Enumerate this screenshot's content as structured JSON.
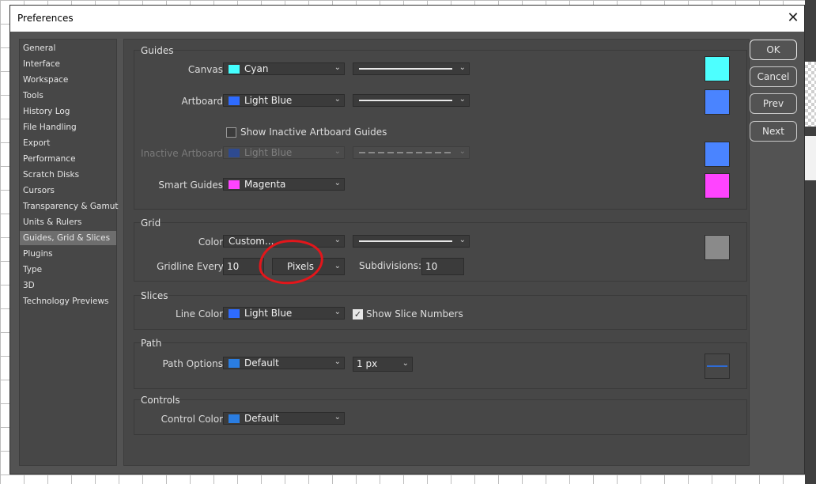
{
  "dialog": {
    "title": "Preferences"
  },
  "sidebar": {
    "items": [
      "General",
      "Interface",
      "Workspace",
      "Tools",
      "History Log",
      "File Handling",
      "Export",
      "Performance",
      "Scratch Disks",
      "Cursors",
      "Transparency & Gamut",
      "Units & Rulers",
      "Guides, Grid & Slices",
      "Plugins",
      "Type",
      "3D",
      "Technology Previews"
    ],
    "selected": "Guides, Grid & Slices"
  },
  "guides": {
    "title": "Guides",
    "canvas": {
      "label": "Canvas:",
      "color_name": "Cyan",
      "color": "#44ffff",
      "swatch": "#4dffff"
    },
    "artboard": {
      "label": "Artboard:",
      "color_name": "Light Blue",
      "color": "#2e6bff",
      "swatch": "#4a84ff"
    },
    "show_inactive": {
      "label": "Show Inactive Artboard Guides",
      "checked": false
    },
    "inactive_artboard": {
      "label": "Inactive Artboard:",
      "color_name": "Light Blue",
      "color": "#2e4a90",
      "swatch": "#4a84ff"
    },
    "smart_guides": {
      "label": "Smart Guides:",
      "color_name": "Magenta",
      "color": "#ff44ff",
      "swatch": "#ff44ff"
    }
  },
  "grid": {
    "title": "Grid",
    "color_label": "Color:",
    "color_value": "Custom...",
    "swatch": "#8a8a8a",
    "gridline_label": "Gridline Every:",
    "gridline_value": "10",
    "unit": "Pixels",
    "subdivisions_label": "Subdivisions:",
    "subdivisions_value": "10"
  },
  "slices": {
    "title": "Slices",
    "line_color_label": "Line Color:",
    "line_color_name": "Light Blue",
    "line_color": "#2e6bff",
    "show_numbers_label": "Show Slice Numbers",
    "show_numbers": true
  },
  "path": {
    "title": "Path",
    "options_label": "Path Options:",
    "options_value": "Default",
    "options_color": "#2a7de1",
    "width_value": "1 px",
    "preview_line": "#2e6bd6"
  },
  "controls": {
    "title": "Controls",
    "color_label": "Control Color:",
    "color_value": "Default",
    "color": "#2a7de1"
  },
  "buttons": {
    "ok": "OK",
    "cancel": "Cancel",
    "prev": "Prev",
    "next": "Next"
  },
  "icons": {
    "close": "close-icon",
    "chevron": "chevron-down-icon"
  }
}
